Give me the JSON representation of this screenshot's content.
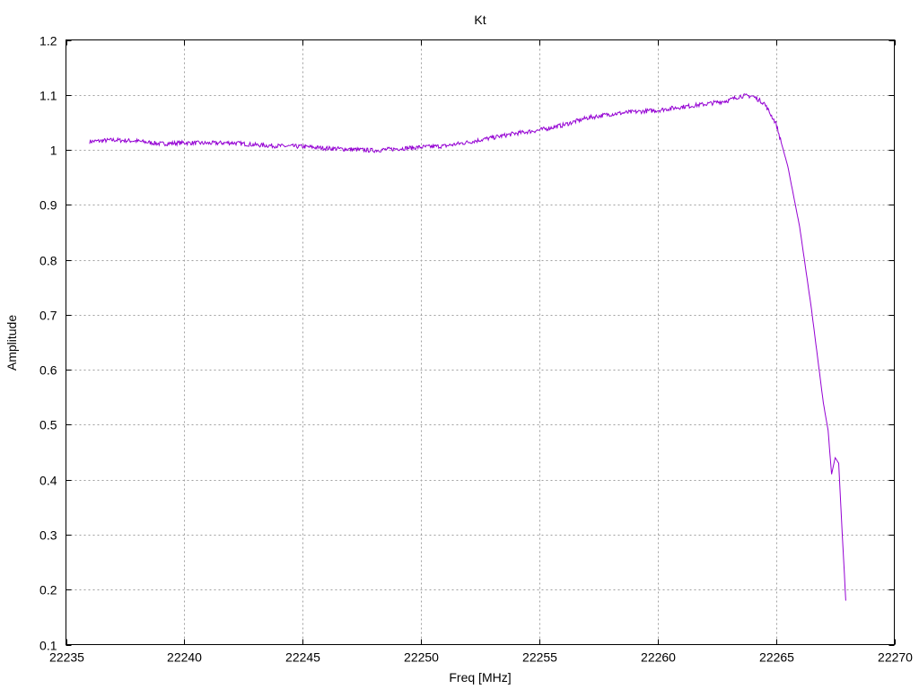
{
  "chart_data": {
    "type": "line",
    "title": "Kt",
    "xlabel": "Freq [MHz]",
    "ylabel": "Amplitude",
    "xlim": [
      22235,
      22270
    ],
    "ylim": [
      0.1,
      1.2
    ],
    "xticks": [
      22235,
      22240,
      22245,
      22250,
      22255,
      22260,
      22265,
      22270
    ],
    "yticks": [
      0.1,
      0.2,
      0.3,
      0.4,
      0.5,
      0.6,
      0.7,
      0.8,
      0.9,
      1,
      1.1,
      1.2
    ],
    "xtick_labels": [
      "22235",
      "22240",
      "22245",
      "22250",
      "22255",
      "22260",
      "22265",
      "22270"
    ],
    "ytick_labels": [
      "0.1",
      "0.2",
      "0.3",
      "0.4",
      "0.5",
      "0.6",
      "0.7",
      "0.8",
      "0.9",
      "1",
      "1.1",
      "1.2"
    ],
    "grid": true,
    "line_color": "#9400d3",
    "series": [
      {
        "x": [
          22236.0,
          22237.0,
          22238.0,
          22239.0,
          22240.0,
          22241.0,
          22242.0,
          22243.0,
          22244.0,
          22245.0,
          22246.0,
          22247.0,
          22248.0,
          22249.0,
          22250.0,
          22251.0,
          22252.0,
          22253.0,
          22254.0,
          22255.0,
          22256.0,
          22257.0,
          22258.0,
          22259.0,
          22260.0,
          22261.0,
          22262.0,
          22263.0,
          22263.5,
          22264.0,
          22264.5,
          22265.0,
          22265.5,
          22266.0,
          22266.5,
          22267.0,
          22267.2,
          22267.35,
          22267.5,
          22267.65,
          22267.8,
          22267.95
        ],
        "y": [
          1.015,
          1.018,
          1.016,
          1.011,
          1.013,
          1.012,
          1.013,
          1.009,
          1.007,
          1.006,
          1.003,
          1.001,
          0.999,
          1.002,
          1.005,
          1.007,
          1.014,
          1.022,
          1.03,
          1.036,
          1.045,
          1.058,
          1.065,
          1.069,
          1.072,
          1.078,
          1.083,
          1.09,
          1.098,
          1.098,
          1.085,
          1.048,
          0.97,
          0.86,
          0.71,
          0.54,
          0.49,
          0.41,
          0.44,
          0.43,
          0.3,
          0.18
        ]
      }
    ]
  }
}
